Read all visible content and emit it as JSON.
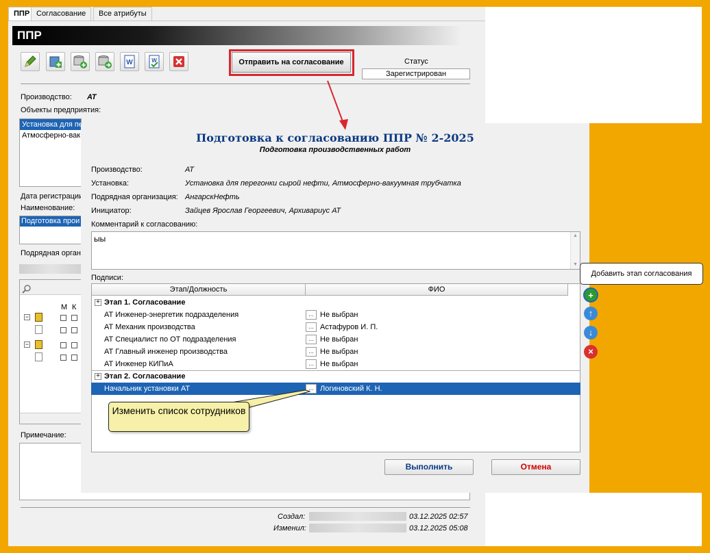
{
  "tabs": [
    "ППР",
    "Согласование",
    "Все атрибуты"
  ],
  "header": {
    "title": "ППР"
  },
  "toolbar": {
    "icons": [
      "pencil-icon",
      "add-document-icon",
      "db-add-icon",
      "db-forward-icon",
      "word-doc-icon",
      "word-check-icon",
      "delete-icon"
    ],
    "send_label": "Отправить на согласование"
  },
  "status": {
    "label": "Статус",
    "value": "Зарегистрирован"
  },
  "form": {
    "production_label": "Производство:",
    "production_value": "АТ",
    "objects_label": "Объекты предприятия:",
    "objects": [
      "Установка для пе",
      "Атмосферно-вак"
    ],
    "reg_date_label": "Дата регистрации",
    "name_label": "Наименование:",
    "name_value": "Подготовка прои",
    "contractor_label": "Подрядная орган",
    "grid_cols": [
      "М",
      "К"
    ],
    "note_label": "Примечание:",
    "created_label": "Создал:",
    "created_date": "03.12.2025 02:57",
    "modified_label": "Изменил:",
    "modified_date": "03.12.2025 05:08"
  },
  "dialog": {
    "title": "Подготовка к согласованию ППР № 2-2025",
    "subtitle": "Подготовка производственных работ",
    "fields": [
      {
        "label": "Производство:",
        "value": "АТ"
      },
      {
        "label": "Установка:",
        "value": "Установка для перегонки сырой нефти, Атмосферно-вакуумная трубчатка"
      },
      {
        "label": "Подрядная организация:",
        "value": "АнгарскНефть"
      },
      {
        "label": "Инициатор:",
        "value": "Зайцев Ярослав Георгеевич, Архивариус АТ"
      }
    ],
    "comment_label": "Комментарий к согласованию:",
    "comment_value": "ыы",
    "signatures_label": "Подписи:",
    "col_stage": "Этап/Должность",
    "col_fio": "ФИО",
    "stage1": {
      "title": "Этап 1. Согласование",
      "rows": [
        {
          "position": "АТ Инженер-энергетик подразделения",
          "fio": "Не выбран"
        },
        {
          "position": "АТ Механик производства",
          "fio": "Астафуров И. П."
        },
        {
          "position": "АТ Специалист по ОТ подразделения",
          "fio": "Не выбран"
        },
        {
          "position": "АТ Главный инженер производства",
          "fio": "Не выбран"
        },
        {
          "position": "АТ Инженер КИПиА",
          "fio": "Не выбран"
        }
      ]
    },
    "stage2": {
      "title": "Этап 2. Согласование",
      "rows": [
        {
          "position": "Начальник установки АТ",
          "fio": "Логиновский К. Н."
        }
      ]
    },
    "dots": "...",
    "plus": "+",
    "ok_label": "Выполнить",
    "cancel_label": "Отмена"
  },
  "tooltip": "Добавить этап согласования",
  "callout": "Изменить список сотрудников",
  "colors": {
    "accent": "#1e64b4",
    "frame": "#f2a700",
    "highlight": "#d9262e",
    "title": "#0b3a82"
  }
}
